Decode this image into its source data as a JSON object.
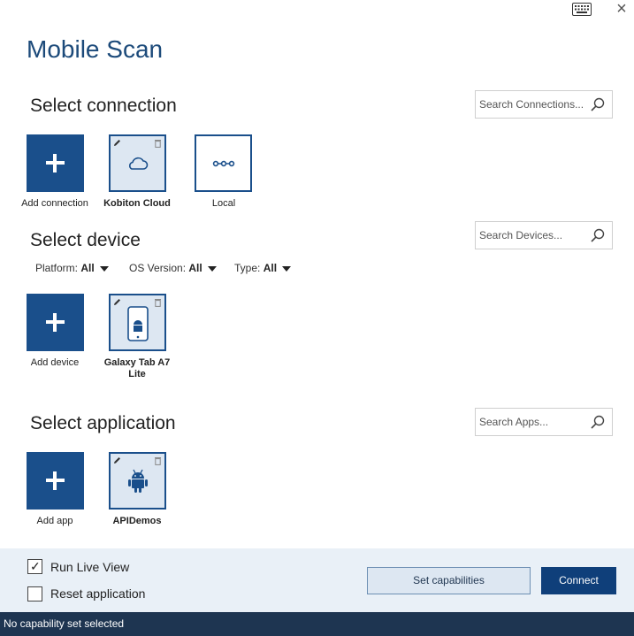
{
  "app": {
    "title": "Mobile Scan"
  },
  "window": {
    "keyboard_icon": "keyboard-icon",
    "close_icon": "close-icon",
    "close_glyph": "×"
  },
  "connection": {
    "title": "Select connection",
    "search_placeholder": "Search Connections...",
    "tiles": [
      {
        "label": "Add connection",
        "icon": "plus-icon"
      },
      {
        "label": "Kobiton Cloud",
        "icon": "cloud-icon",
        "selected": true
      },
      {
        "label": "Local",
        "icon": "local-connection-icon"
      }
    ]
  },
  "device": {
    "title": "Select device",
    "search_placeholder": "Search Devices...",
    "filters": [
      {
        "label": "Platform:",
        "value": "All"
      },
      {
        "label": "OS Version:",
        "value": "All"
      },
      {
        "label": "Type:",
        "value": "All"
      }
    ],
    "tiles": [
      {
        "label": "Add device",
        "icon": "plus-icon"
      },
      {
        "label": "Galaxy Tab A7 Lite",
        "icon": "android-phone-icon",
        "selected": true
      }
    ]
  },
  "application": {
    "title": "Select application",
    "search_placeholder": "Search Apps...",
    "tiles": [
      {
        "label": "Add app",
        "icon": "plus-icon"
      },
      {
        "label": "APIDemos",
        "icon": "android-icon",
        "selected": true
      }
    ]
  },
  "options": {
    "run_live_view": {
      "label": "Run Live View",
      "checked": true,
      "check_glyph": "✓"
    },
    "reset_application": {
      "label": "Reset application",
      "checked": false
    }
  },
  "buttons": {
    "set_capabilities": "Set capabilities",
    "connect": "Connect"
  },
  "status": {
    "text": "No capability set selected"
  },
  "colors": {
    "accent": "#1a4f8b",
    "title": "#1c4a7a",
    "status_bar": "#1e3551",
    "footer": "#e9f0f7",
    "selected_tile": "#dde7f2"
  }
}
